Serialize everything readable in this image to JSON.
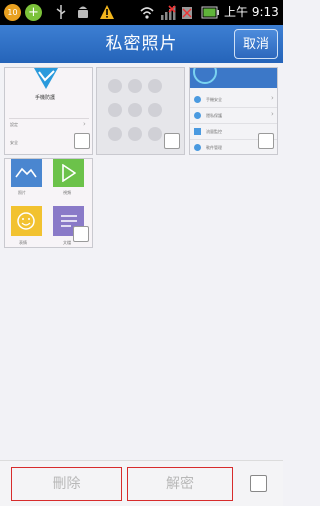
{
  "status": {
    "notification_count": "10",
    "clock": "上午 9:13"
  },
  "header": {
    "title": "私密照片",
    "cancel_label": "取消"
  },
  "photos": [
    {
      "desc": "security app screen",
      "line1": "手機防護",
      "line2": "設定",
      "line3": "安全"
    },
    {
      "desc": "pattern lock screen"
    },
    {
      "desc": "security settings list",
      "items": [
        "手機安全",
        "隱私保護",
        "流量監控",
        "軟件管理"
      ]
    },
    {
      "desc": "app icons grid",
      "labels": [
        "照片",
        "視頻",
        "表情",
        "文檔"
      ]
    }
  ],
  "bottom": {
    "delete_label": "刪除",
    "decrypt_label": "解密"
  },
  "colors": {
    "header": "#2e6fc5",
    "accent_border": "#d72c2c",
    "disabled_text": "#b8b8b8"
  }
}
